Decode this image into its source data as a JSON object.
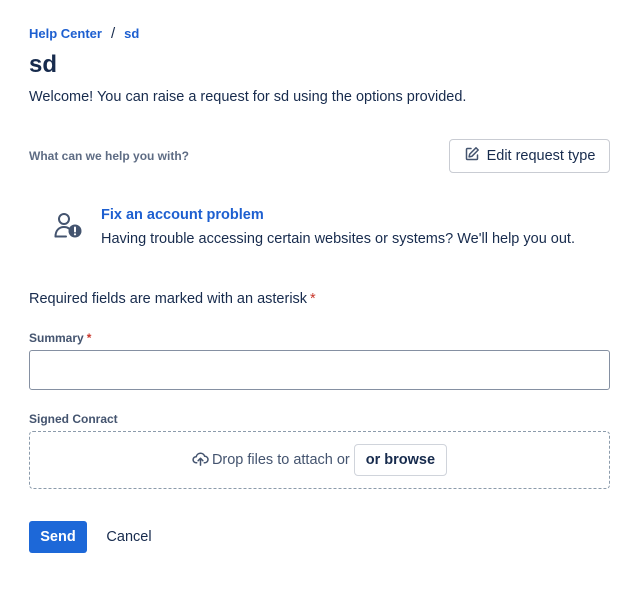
{
  "breadcrumb": {
    "home": "Help Center",
    "separator": "/",
    "current": "sd"
  },
  "page": {
    "title": "sd",
    "welcome": "Welcome! You can raise a request for sd using the options provided."
  },
  "request_type_section": {
    "label": "What can we help you with?",
    "edit_button_label": "Edit request type",
    "edit_icon": "edit-icon"
  },
  "request_type": {
    "icon": "user-warning-icon",
    "title": "Fix an account problem",
    "description": "Having trouble accessing certain websites or systems? We'll help you out."
  },
  "form": {
    "required_note": "Required fields are marked with an asterisk",
    "asterisk": "*",
    "summary": {
      "label": "Summary",
      "value": "",
      "placeholder": ""
    },
    "attachment": {
      "label": "Signed Conract",
      "drop_text": "Drop files to attach or",
      "browse_label": "or browse",
      "icon": "cloud-upload-icon"
    }
  },
  "actions": {
    "send_label": "Send",
    "cancel_label": "Cancel"
  },
  "colors": {
    "link": "#1d5fd0",
    "primary": "#1d68d8",
    "required": "#c9372c",
    "text": "#172b4d"
  }
}
